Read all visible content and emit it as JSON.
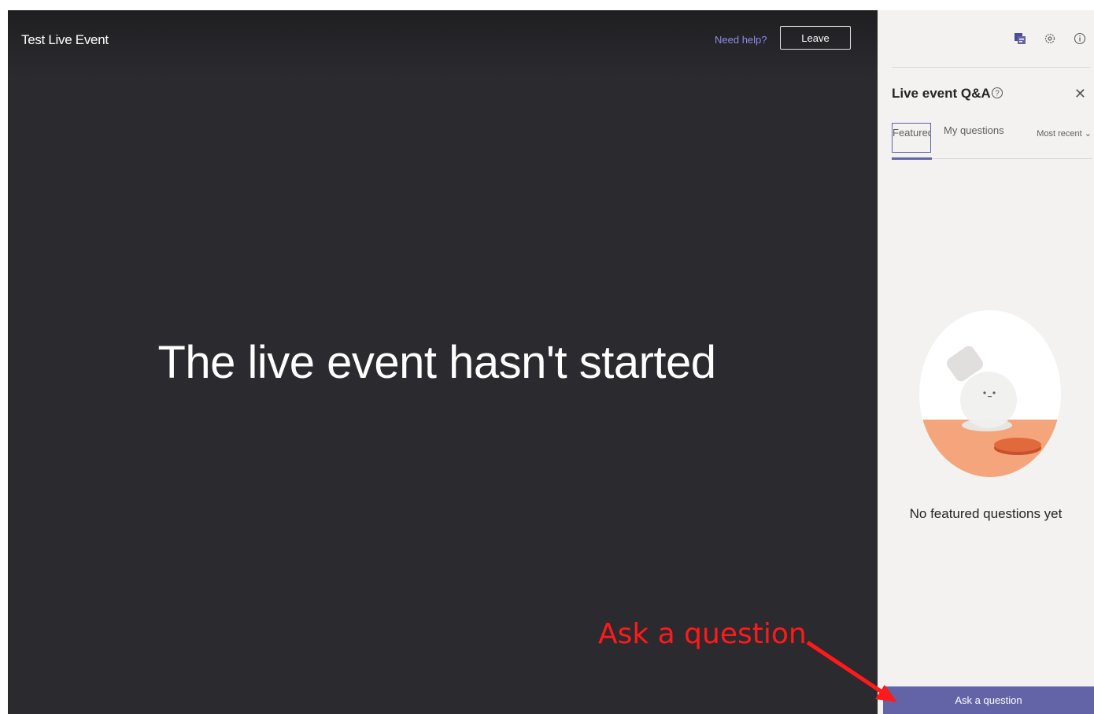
{
  "event": {
    "title": "Test Live Event",
    "need_help": "Need help?",
    "leave": "Leave",
    "status_message": "The live event hasn't started"
  },
  "panel": {
    "icons": [
      "qa-icon",
      "settings-icon",
      "info-icon"
    ],
    "title": "Live event Q&A",
    "tabs": {
      "featured": "Featured",
      "my_questions": "My questions"
    },
    "sort": "Most recent",
    "empty_message": "No featured questions yet",
    "ask_button": "Ask a question"
  },
  "annotation": {
    "label": "Ask a question",
    "color": "#ff1a1a"
  },
  "colors": {
    "accent": "#6264a7",
    "stage": "#2b2a2f",
    "panel": "#f3f2f1"
  }
}
